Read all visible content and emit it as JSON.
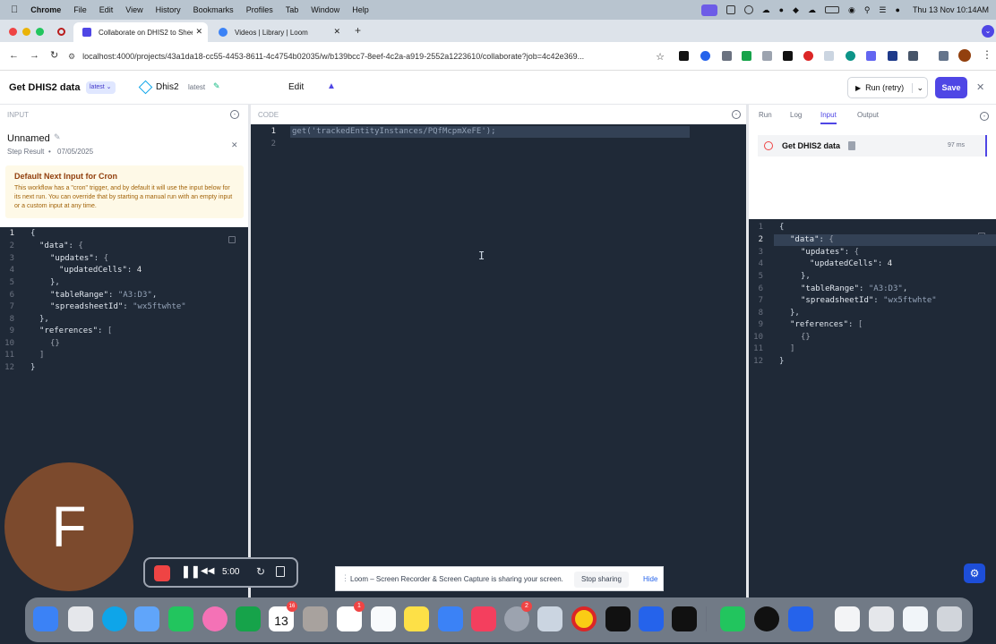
{
  "menubar": {
    "app": "Chrome",
    "items": [
      "File",
      "Edit",
      "View",
      "History",
      "Bookmarks",
      "Profiles",
      "Tab",
      "Window",
      "Help"
    ],
    "clock": "Thu 13 Nov  10:14AM"
  },
  "tabs": [
    {
      "label": "Collaborate on DHIS2 to Shee"
    },
    {
      "label": "Videos | Library | Loom"
    }
  ],
  "url": "localhost:4000/projects/43a1da18-cc55-4453-8611-4c4754b02035/w/b139bcc7-8eef-4c2a-a919-2552a1223610/collaborate?job=4c42e369...",
  "header": {
    "title": "Get DHIS2 data",
    "version_badge": "latest",
    "adaptor_name": "Dhis2",
    "adaptor_version": "latest",
    "edit_label": "Edit",
    "run_label": "Run (retry)",
    "save_label": "Save"
  },
  "input_panel": {
    "header": "INPUT",
    "name": "Unnamed",
    "step_result": "Step Result",
    "date": "07/05/2025",
    "notice_title": "Default Next Input for Cron",
    "notice_body": "This workflow has a \"cron\" trigger, and by default it will use the input below for its next run. You can override that by starting a manual run with an empty input or a custom input at any time."
  },
  "code_panel": {
    "header": "CODE",
    "line1": "get('trackedEntityInstances/PQfMcpmXeFE');"
  },
  "right_panel": {
    "tabs": [
      "Run",
      "Log",
      "Input",
      "Output"
    ],
    "active_tab": "Input",
    "step_name": "Get DHIS2 data",
    "duration": "97 ms"
  },
  "json_input": {
    "updatedCells": "4",
    "tableRange": "\"A3:D3\"",
    "spreadsheetId": "\"wx5ftwhte\""
  },
  "avatar_letter": "F",
  "recorder": {
    "time": "5:00"
  },
  "share_bar": {
    "text": "Loom – Screen Recorder & Screen Capture is sharing your screen.",
    "stop_label": "Stop sharing",
    "hide_label": "Hide"
  },
  "dock": {
    "calendar_day": "13",
    "calendar_badge": "16",
    "reminders_badge": "1",
    "settings_badge": "2"
  },
  "colors": {
    "accent": "#4f46e5",
    "panel_bg": "#1f2937",
    "menubar": "#b8c4cf"
  }
}
